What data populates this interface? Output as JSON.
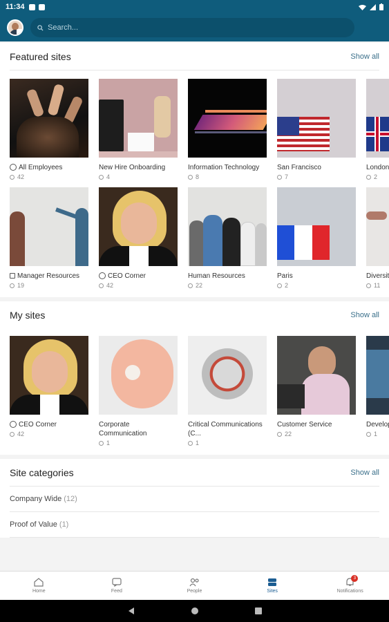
{
  "statusbar": {
    "time": "11:34"
  },
  "search": {
    "placeholder": "Search..."
  },
  "featured": {
    "title": "Featured sites",
    "show_all": "Show all",
    "row1": [
      {
        "name": "All Employees",
        "count": "42",
        "icon": "check-circle"
      },
      {
        "name": "New Hire Onboarding",
        "count": "4"
      },
      {
        "name": "Information Technology",
        "count": "8"
      },
      {
        "name": "San Francisco",
        "count": "7"
      },
      {
        "name": "London",
        "count": "2"
      }
    ],
    "row2": [
      {
        "name": "Manager Resources",
        "count": "19",
        "icon": "lock"
      },
      {
        "name": "CEO Corner",
        "count": "42",
        "icon": "check-circle"
      },
      {
        "name": "Human Resources",
        "count": "22"
      },
      {
        "name": "Paris",
        "count": "2"
      },
      {
        "name": "Diversity & Inclusion",
        "count": "11"
      }
    ]
  },
  "my_sites": {
    "title": "My sites",
    "show_all": "Show all",
    "items": [
      {
        "name": "CEO Corner",
        "count": "42",
        "icon": "check-circle"
      },
      {
        "name": "Corporate Communication",
        "count": "1"
      },
      {
        "name": "Critical Communications (C...",
        "count": "1"
      },
      {
        "name": "Customer Service",
        "count": "22"
      },
      {
        "name": "Development",
        "count": "1"
      }
    ]
  },
  "categories": {
    "title": "Site categories",
    "show_all": "Show all",
    "items": [
      {
        "name": "Company Wide",
        "count": "(12)"
      },
      {
        "name": "Proof of Value",
        "count": "(1)"
      }
    ]
  },
  "nav": {
    "home": "Home",
    "feed": "Feed",
    "people": "People",
    "sites": "Sites",
    "notifications": "Notifications",
    "notif_badge": "3"
  },
  "colors": {
    "brand": "#0f5c7c",
    "accent": "#1b5d92"
  }
}
